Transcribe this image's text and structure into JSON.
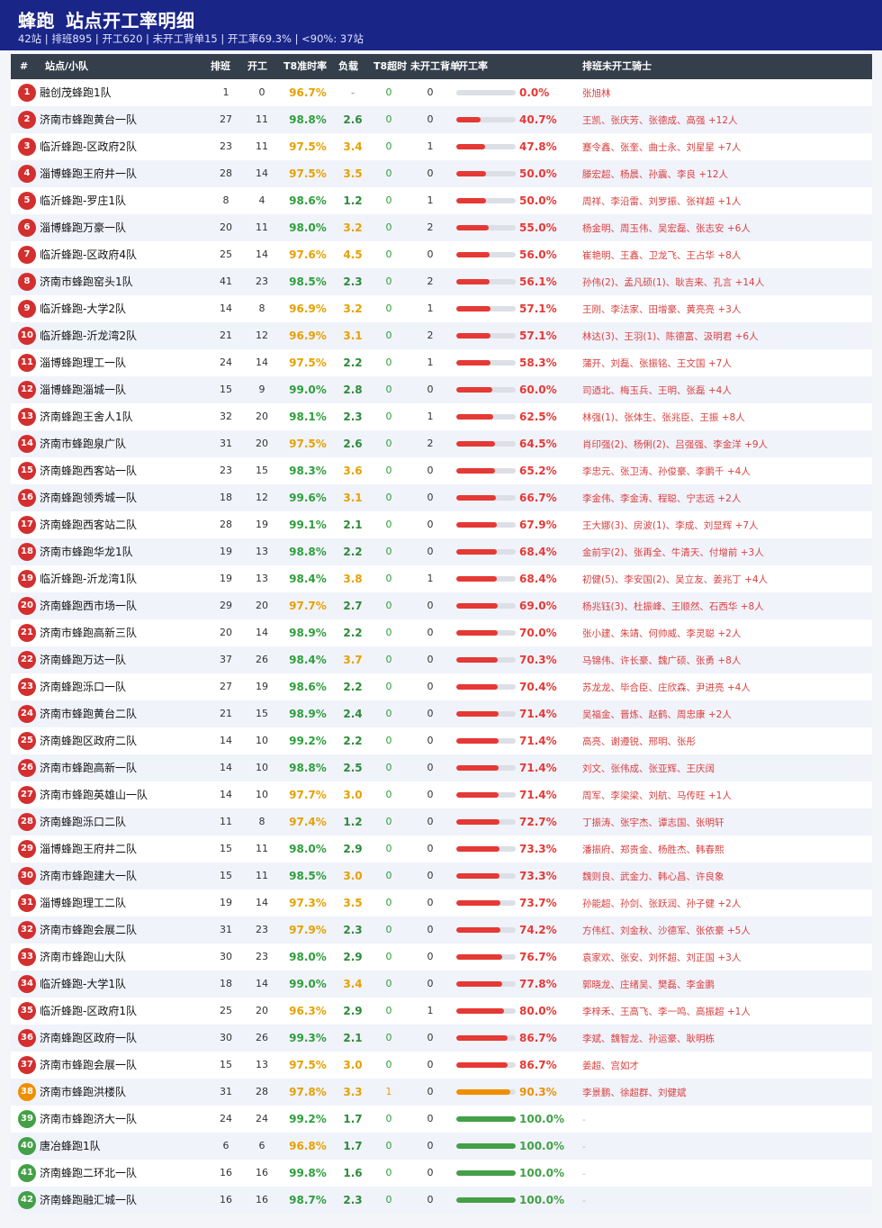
{
  "header": {
    "title_brand": "蜂跑",
    "title_text": "站点开工率明细",
    "subtitle": "42站 | 排班895 | 开工620 | 未开工背单15 | 开工率69.3% | <90%: 37站"
  },
  "columns": {
    "rank": "#",
    "station": "站点/小队",
    "scheduled": "排班",
    "working": "开工",
    "t8_rate": "T8准时率",
    "load": "负载",
    "t8_overtime": "T8超时",
    "unworked_backorder": "未开工背单",
    "work_rate": "开工率",
    "unworked_riders": "排班未开工骑士"
  },
  "colors": {
    "header_bg": "#1a2588",
    "table_header_bg": "#343f4b",
    "bad": "#e53935",
    "warn": "#ef8f00",
    "good": "#43a047"
  },
  "rows": [
    {
      "rank": "1",
      "name": "融创茂蜂跑1队",
      "sched": "1",
      "work": "0",
      "t8": "96.7%",
      "load": "-",
      "over": "0",
      "back": "0",
      "rate": 0.0,
      "rate_text": "0.0%",
      "riders": "张旭林"
    },
    {
      "rank": "2",
      "name": "济南市蜂跑黄台一队",
      "sched": "27",
      "work": "11",
      "t8": "98.8%",
      "load": "2.6",
      "over": "0",
      "back": "0",
      "rate": 40.7,
      "rate_text": "40.7%",
      "riders": "王凯、张庆芳、张德成、高强 +12人"
    },
    {
      "rank": "3",
      "name": "临沂蜂跑-区政府2队",
      "sched": "23",
      "work": "11",
      "t8": "97.5%",
      "load": "3.4",
      "over": "0",
      "back": "1",
      "rate": 47.8,
      "rate_text": "47.8%",
      "riders": "蹇令鑫、张奎、曲士永、刘星星 +7人"
    },
    {
      "rank": "4",
      "name": "淄博蜂跑王府井一队",
      "sched": "28",
      "work": "14",
      "t8": "97.5%",
      "load": "3.5",
      "over": "0",
      "back": "0",
      "rate": 50.0,
      "rate_text": "50.0%",
      "riders": "滕宏超、杨晨、孙震、李良 +12人"
    },
    {
      "rank": "5",
      "name": "临沂蜂跑-罗庄1队",
      "sched": "8",
      "work": "4",
      "t8": "98.6%",
      "load": "1.2",
      "over": "0",
      "back": "1",
      "rate": 50.0,
      "rate_text": "50.0%",
      "riders": "周祥、李沿雷、刘罗振、张祥超 +1人"
    },
    {
      "rank": "6",
      "name": "淄博蜂跑万豪一队",
      "sched": "20",
      "work": "11",
      "t8": "98.0%",
      "load": "3.2",
      "over": "0",
      "back": "2",
      "rate": 55.0,
      "rate_text": "55.0%",
      "riders": "杨金明、周玉伟、吴宏磊、张志安 +6人"
    },
    {
      "rank": "7",
      "name": "临沂蜂跑-区政府4队",
      "sched": "25",
      "work": "14",
      "t8": "97.6%",
      "load": "4.5",
      "over": "0",
      "back": "0",
      "rate": 56.0,
      "rate_text": "56.0%",
      "riders": "崔艳明、王鑫、卫龙飞、王占华 +8人"
    },
    {
      "rank": "8",
      "name": "济南市蜂跑窑头1队",
      "sched": "41",
      "work": "23",
      "t8": "98.5%",
      "load": "2.3",
      "over": "0",
      "back": "2",
      "rate": 56.1,
      "rate_text": "56.1%",
      "riders": "孙伟(2)、孟凡硕(1)、耿吉来、孔言 +14人"
    },
    {
      "rank": "9",
      "name": "临沂蜂跑-大学2队",
      "sched": "14",
      "work": "8",
      "t8": "96.9%",
      "load": "3.2",
      "over": "0",
      "back": "1",
      "rate": 57.1,
      "rate_text": "57.1%",
      "riders": "王刚、李法家、田增豪、黄亮亮 +3人"
    },
    {
      "rank": "10",
      "name": "临沂蜂跑-沂龙湾2队",
      "sched": "21",
      "work": "12",
      "t8": "96.9%",
      "load": "3.1",
      "over": "0",
      "back": "2",
      "rate": 57.1,
      "rate_text": "57.1%",
      "riders": "林达(3)、王羽(1)、陈德富、汲明君 +6人"
    },
    {
      "rank": "11",
      "name": "淄博蜂跑理工一队",
      "sched": "24",
      "work": "14",
      "t8": "97.5%",
      "load": "2.2",
      "over": "0",
      "back": "1",
      "rate": 58.3,
      "rate_text": "58.3%",
      "riders": "蒲开、刘磊、张振铭、王文国 +7人"
    },
    {
      "rank": "12",
      "name": "淄博蜂跑淄城一队",
      "sched": "15",
      "work": "9",
      "t8": "99.0%",
      "load": "2.8",
      "over": "0",
      "back": "0",
      "rate": 60.0,
      "rate_text": "60.0%",
      "riders": "司迺北、梅玉兵、王明、张磊 +4人"
    },
    {
      "rank": "13",
      "name": "济南蜂跑王舍人1队",
      "sched": "32",
      "work": "20",
      "t8": "98.1%",
      "load": "2.3",
      "over": "0",
      "back": "1",
      "rate": 62.5,
      "rate_text": "62.5%",
      "riders": "林强(1)、张体生、张兆臣、王振 +8人"
    },
    {
      "rank": "14",
      "name": "济南市蜂跑泉广队",
      "sched": "31",
      "work": "20",
      "t8": "97.5%",
      "load": "2.6",
      "over": "0",
      "back": "2",
      "rate": 64.5,
      "rate_text": "64.5%",
      "riders": "肖印强(2)、杨俐(2)、吕强强、李金洋 +9人"
    },
    {
      "rank": "15",
      "name": "济南蜂跑西客站一队",
      "sched": "23",
      "work": "15",
      "t8": "98.3%",
      "load": "3.6",
      "over": "0",
      "back": "0",
      "rate": 65.2,
      "rate_text": "65.2%",
      "riders": "李忠元、张卫涛、孙俊豪、李鹏千 +4人"
    },
    {
      "rank": "16",
      "name": "济南蜂跑领秀城一队",
      "sched": "18",
      "work": "12",
      "t8": "99.6%",
      "load": "3.1",
      "over": "0",
      "back": "0",
      "rate": 66.7,
      "rate_text": "66.7%",
      "riders": "李金伟、李金涛、程聪、宁志远 +2人"
    },
    {
      "rank": "17",
      "name": "济南蜂跑西客站二队",
      "sched": "28",
      "work": "19",
      "t8": "99.1%",
      "load": "2.1",
      "over": "0",
      "back": "0",
      "rate": 67.9,
      "rate_text": "67.9%",
      "riders": "王大娜(3)、房波(1)、李成、刘显辉 +7人"
    },
    {
      "rank": "18",
      "name": "济南市蜂跑华龙1队",
      "sched": "19",
      "work": "13",
      "t8": "98.8%",
      "load": "2.2",
      "over": "0",
      "back": "0",
      "rate": 68.4,
      "rate_text": "68.4%",
      "riders": "金前宇(2)、张再全、牛清天、付增前 +3人"
    },
    {
      "rank": "19",
      "name": "临沂蜂跑-沂龙湾1队",
      "sched": "19",
      "work": "13",
      "t8": "98.4%",
      "load": "3.8",
      "over": "0",
      "back": "1",
      "rate": 68.4,
      "rate_text": "68.4%",
      "riders": "初健(5)、李安国(2)、吴立友、姜兆丁 +4人"
    },
    {
      "rank": "20",
      "name": "济南蜂跑西市场一队",
      "sched": "29",
      "work": "20",
      "t8": "97.7%",
      "load": "2.7",
      "over": "0",
      "back": "0",
      "rate": 69.0,
      "rate_text": "69.0%",
      "riders": "杨兆钰(3)、杜振峰、王顺然、石西华 +8人"
    },
    {
      "rank": "21",
      "name": "济南市蜂跑高新三队",
      "sched": "20",
      "work": "14",
      "t8": "98.9%",
      "load": "2.2",
      "over": "0",
      "back": "0",
      "rate": 70.0,
      "rate_text": "70.0%",
      "riders": "张小建、朱靖、何帅威、李灵聪 +2人"
    },
    {
      "rank": "22",
      "name": "济南蜂跑万达一队",
      "sched": "37",
      "work": "26",
      "t8": "98.4%",
      "load": "3.7",
      "over": "0",
      "back": "0",
      "rate": 70.3,
      "rate_text": "70.3%",
      "riders": "马锦伟、许长豪、魏广硕、张勇 +8人"
    },
    {
      "rank": "23",
      "name": "济南蜂跑泺口一队",
      "sched": "27",
      "work": "19",
      "t8": "98.6%",
      "load": "2.2",
      "over": "0",
      "back": "0",
      "rate": 70.4,
      "rate_text": "70.4%",
      "riders": "苏龙龙、毕合臣、庄欣森、尹进亮 +4人"
    },
    {
      "rank": "24",
      "name": "济南市蜂跑黄台二队",
      "sched": "21",
      "work": "15",
      "t8": "98.9%",
      "load": "2.4",
      "over": "0",
      "back": "0",
      "rate": 71.4,
      "rate_text": "71.4%",
      "riders": "吴福金、晋炼、赵鹤、周忠康 +2人"
    },
    {
      "rank": "25",
      "name": "济南蜂跑区政府二队",
      "sched": "14",
      "work": "10",
      "t8": "99.2%",
      "load": "2.2",
      "over": "0",
      "back": "0",
      "rate": 71.4,
      "rate_text": "71.4%",
      "riders": "高亮、谢遵锐、邢明、张彤"
    },
    {
      "rank": "26",
      "name": "济南市蜂跑高新一队",
      "sched": "14",
      "work": "10",
      "t8": "98.8%",
      "load": "2.5",
      "over": "0",
      "back": "0",
      "rate": 71.4,
      "rate_text": "71.4%",
      "riders": "刘文、张伟成、张亚辉、王庆阔"
    },
    {
      "rank": "27",
      "name": "济南市蜂跑英雄山一队",
      "sched": "14",
      "work": "10",
      "t8": "97.7%",
      "load": "3.0",
      "over": "0",
      "back": "0",
      "rate": 71.4,
      "rate_text": "71.4%",
      "riders": "周军、李梁梁、刘航、马传旺 +1人"
    },
    {
      "rank": "28",
      "name": "济南蜂跑泺口二队",
      "sched": "11",
      "work": "8",
      "t8": "97.4%",
      "load": "1.2",
      "over": "0",
      "back": "0",
      "rate": 72.7,
      "rate_text": "72.7%",
      "riders": "丁振涛、张宇杰、谭志国、张明轩"
    },
    {
      "rank": "29",
      "name": "淄博蜂跑王府井二队",
      "sched": "15",
      "work": "11",
      "t8": "98.0%",
      "load": "2.9",
      "over": "0",
      "back": "0",
      "rate": 73.3,
      "rate_text": "73.3%",
      "riders": "潘振府、郑贵金、杨胜杰、韩春熙"
    },
    {
      "rank": "30",
      "name": "济南市蜂跑建大一队",
      "sched": "15",
      "work": "11",
      "t8": "98.5%",
      "load": "3.0",
      "over": "0",
      "back": "0",
      "rate": 73.3,
      "rate_text": "73.3%",
      "riders": "魏则良、武金力、韩心昌、许良象"
    },
    {
      "rank": "31",
      "name": "淄博蜂跑理工二队",
      "sched": "19",
      "work": "14",
      "t8": "97.3%",
      "load": "3.5",
      "over": "0",
      "back": "0",
      "rate": 73.7,
      "rate_text": "73.7%",
      "riders": "孙能超、孙剑、张跃润、孙子健 +2人"
    },
    {
      "rank": "32",
      "name": "济南市蜂跑会展二队",
      "sched": "31",
      "work": "23",
      "t8": "97.9%",
      "load": "2.3",
      "over": "0",
      "back": "0",
      "rate": 74.2,
      "rate_text": "74.2%",
      "riders": "方伟红、刘金秋、沙德军、张依豪 +5人"
    },
    {
      "rank": "33",
      "name": "济南市蜂跑山大队",
      "sched": "30",
      "work": "23",
      "t8": "98.0%",
      "load": "2.9",
      "over": "0",
      "back": "0",
      "rate": 76.7,
      "rate_text": "76.7%",
      "riders": "袁家欢、张安、刘怀超、刘正国 +3人"
    },
    {
      "rank": "34",
      "name": "临沂蜂跑-大学1队",
      "sched": "18",
      "work": "14",
      "t8": "99.0%",
      "load": "3.4",
      "over": "0",
      "back": "0",
      "rate": 77.8,
      "rate_text": "77.8%",
      "riders": "郭晓龙、庄绪吴、樊磊、李金鹏"
    },
    {
      "rank": "35",
      "name": "临沂蜂跑-区政府1队",
      "sched": "25",
      "work": "20",
      "t8": "96.3%",
      "load": "2.9",
      "over": "0",
      "back": "1",
      "rate": 80.0,
      "rate_text": "80.0%",
      "riders": "李梓禾、王高飞、李一鸣、高振超 +1人"
    },
    {
      "rank": "36",
      "name": "济南蜂跑区政府一队",
      "sched": "30",
      "work": "26",
      "t8": "99.3%",
      "load": "2.1",
      "over": "0",
      "back": "0",
      "rate": 86.7,
      "rate_text": "86.7%",
      "riders": "李斌、魏智龙、孙运豪、耿明栋"
    },
    {
      "rank": "37",
      "name": "济南市蜂跑会展一队",
      "sched": "15",
      "work": "13",
      "t8": "97.5%",
      "load": "3.0",
      "over": "0",
      "back": "0",
      "rate": 86.7,
      "rate_text": "86.7%",
      "riders": "姜超、宫如才"
    },
    {
      "rank": "38",
      "name": "济南市蜂跑洪楼队",
      "sched": "31",
      "work": "28",
      "t8": "97.8%",
      "load": "3.3",
      "over": "1",
      "back": "0",
      "rate": 90.3,
      "rate_text": "90.3%",
      "riders": "李景鹏、徐超群、刘健斌"
    },
    {
      "rank": "39",
      "name": "济南市蜂跑济大一队",
      "sched": "24",
      "work": "24",
      "t8": "99.2%",
      "load": "1.7",
      "over": "0",
      "back": "0",
      "rate": 100.0,
      "rate_text": "100.0%",
      "riders": "-"
    },
    {
      "rank": "40",
      "name": "唐冶蜂跑1队",
      "sched": "6",
      "work": "6",
      "t8": "96.8%",
      "load": "1.7",
      "over": "0",
      "back": "0",
      "rate": 100.0,
      "rate_text": "100.0%",
      "riders": "-"
    },
    {
      "rank": "41",
      "name": "济南蜂跑二环北一队",
      "sched": "16",
      "work": "16",
      "t8": "99.8%",
      "load": "1.6",
      "over": "0",
      "back": "0",
      "rate": 100.0,
      "rate_text": "100.0%",
      "riders": "-"
    },
    {
      "rank": "42",
      "name": "济南蜂跑融汇城一队",
      "sched": "16",
      "work": "16",
      "t8": "98.7%",
      "load": "2.3",
      "over": "0",
      "back": "0",
      "rate": 100.0,
      "rate_text": "100.0%",
      "riders": "-"
    }
  ]
}
